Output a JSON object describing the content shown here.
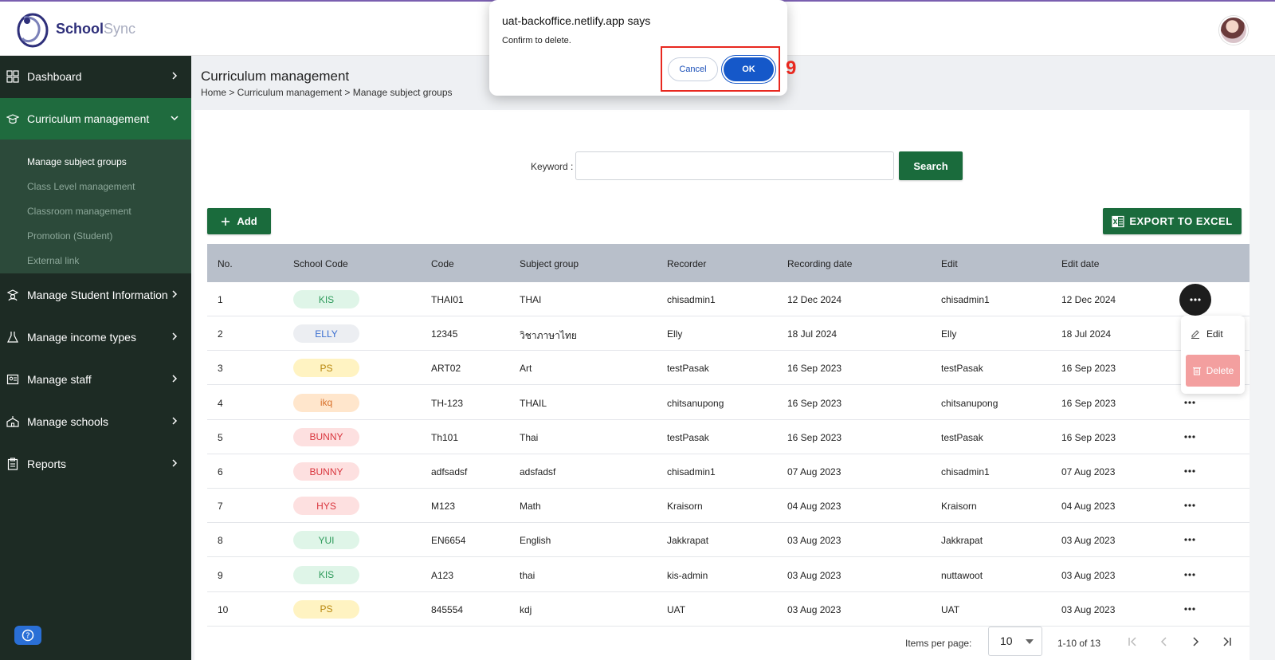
{
  "brand": {
    "name_part1": "School",
    "name_part2": "Sync"
  },
  "dialog": {
    "title": "uat-backoffice.netlify.app says",
    "message": "Confirm to delete.",
    "cancel_label": "Cancel",
    "ok_label": "OK",
    "annotation": "9"
  },
  "sidebar": {
    "items": [
      {
        "label": "Dashboard"
      },
      {
        "label": "Curriculum management"
      },
      {
        "label": "Manage Student Information"
      },
      {
        "label": "Manage income types"
      },
      {
        "label": "Manage staff"
      },
      {
        "label": "Manage schools"
      },
      {
        "label": "Reports"
      }
    ],
    "submenu": [
      {
        "label": "Manage subject groups"
      },
      {
        "label": "Class Level management"
      },
      {
        "label": "Classroom management"
      },
      {
        "label": "Promotion (Student)"
      },
      {
        "label": "External link"
      }
    ]
  },
  "page": {
    "title": "Curriculum management",
    "breadcrumb": "Home > Curriculum management > Manage subject groups"
  },
  "search": {
    "label": "Keyword :",
    "value": "",
    "button_label": "Search"
  },
  "toolbar": {
    "add_label": "Add",
    "export_label": "EXPORT TO EXCEL"
  },
  "table": {
    "headers": [
      "No.",
      "School Code",
      "Code",
      "Subject group",
      "Recorder",
      "Recording date",
      "Edit",
      "Edit date"
    ],
    "rows": [
      {
        "no": "1",
        "school_code": "KIS",
        "badge": "green",
        "code": "THAI01",
        "subject_group": "THAI",
        "recorder": "chisadmin1",
        "recording_date": "12 Dec 2024",
        "edit": "chisadmin1",
        "edit_date": "12 Dec 2024"
      },
      {
        "no": "2",
        "school_code": "ELLY",
        "badge": "gray",
        "code": "12345",
        "subject_group": "วิชาภาษาไทย",
        "recorder": "Elly",
        "recording_date": "18 Jul 2024",
        "edit": "Elly",
        "edit_date": "18 Jul 2024"
      },
      {
        "no": "3",
        "school_code": "PS",
        "badge": "yellow",
        "code": "ART02",
        "subject_group": "Art",
        "recorder": "testPasak",
        "recording_date": "16 Sep 2023",
        "edit": "testPasak",
        "edit_date": "16 Sep 2023"
      },
      {
        "no": "4",
        "school_code": "ikq",
        "badge": "orange",
        "code": "TH-123",
        "subject_group": "THAIL",
        "recorder": "chitsanupong",
        "recording_date": "16 Sep 2023",
        "edit": "chitsanupong",
        "edit_date": "16 Sep 2023"
      },
      {
        "no": "5",
        "school_code": "BUNNY",
        "badge": "red",
        "code": "Th101",
        "subject_group": "Thai",
        "recorder": "testPasak",
        "recording_date": "16 Sep 2023",
        "edit": "testPasak",
        "edit_date": "16 Sep 2023"
      },
      {
        "no": "6",
        "school_code": "BUNNY",
        "badge": "red",
        "code": "adfsadsf",
        "subject_group": "adsfadsf",
        "recorder": "chisadmin1",
        "recording_date": "07 Aug 2023",
        "edit": "chisadmin1",
        "edit_date": "07 Aug 2023"
      },
      {
        "no": "7",
        "school_code": "HYS",
        "badge": "red",
        "code": "M123",
        "subject_group": "Math",
        "recorder": "Kraisorn",
        "recording_date": "04 Aug 2023",
        "edit": "Kraisorn",
        "edit_date": "04 Aug 2023"
      },
      {
        "no": "8",
        "school_code": "YUI",
        "badge": "green",
        "code": "EN6654",
        "subject_group": "English",
        "recorder": "Jakkrapat",
        "recording_date": "03 Aug 2023",
        "edit": "Jakkrapat",
        "edit_date": "03 Aug 2023"
      },
      {
        "no": "9",
        "school_code": "KIS",
        "badge": "green",
        "code": "A123",
        "subject_group": "thai",
        "recorder": "kis-admin",
        "recording_date": "03 Aug 2023",
        "edit": "nuttawoot",
        "edit_date": "03 Aug 2023"
      },
      {
        "no": "10",
        "school_code": "PS",
        "badge": "yellow",
        "code": "845554",
        "subject_group": "kdj",
        "recorder": "UAT",
        "recording_date": "03 Aug 2023",
        "edit": "UAT",
        "edit_date": "03 Aug 2023"
      }
    ]
  },
  "row_menu": {
    "edit_label": "Edit",
    "delete_label": "Delete"
  },
  "pagination": {
    "items_per_page_label": "Items per page:",
    "page_size": "10",
    "range": "1-10 of 13"
  },
  "colors": {
    "sidebar_bg": "#1d2b24",
    "active_green": "#1f6b3c",
    "primary_blue": "#1558c9",
    "highlight_red": "#e8281f",
    "badge_green_bg": "#dff5e8",
    "badge_green_fg": "#2f9b5c",
    "badge_gray_bg": "#eceef2",
    "badge_gray_fg": "#3b6fd0",
    "badge_yellow_bg": "#fff3c2",
    "badge_yellow_fg": "#b7860b",
    "badge_orange_bg": "#ffe6cc",
    "badge_orange_fg": "#d8702a",
    "badge_red_bg": "#fde0e0",
    "badge_red_fg": "#d9363e"
  }
}
